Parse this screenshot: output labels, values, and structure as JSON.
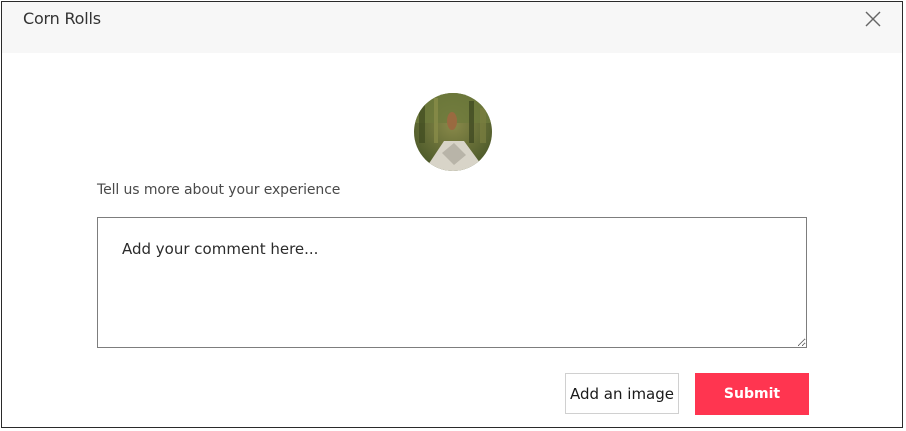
{
  "modal": {
    "title": "Corn Rolls",
    "close_icon": "close-icon"
  },
  "avatar": {
    "alt": "reviewer photo"
  },
  "form": {
    "prompt": "Tell us more about your experience",
    "comment_placeholder": "Add your comment here...",
    "comment_value": "",
    "add_image_label": "Add an image",
    "submit_label": "Submit"
  },
  "colors": {
    "accent": "#ff3550",
    "header_bg": "#f7f7f7",
    "border": "#7d7d7d"
  }
}
